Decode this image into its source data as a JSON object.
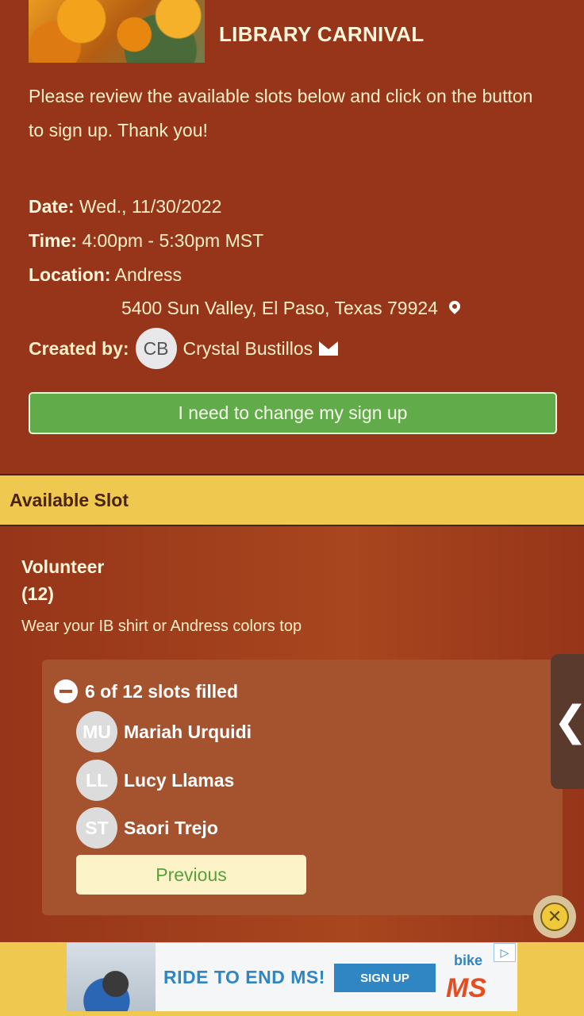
{
  "event": {
    "title": "LIBRARY CARNIVAL",
    "intro": "Please review the available slots below and click on the button to sign up. Thank you!"
  },
  "details": {
    "date_label": "Date:",
    "date_value": "Wed., 11/30/2022",
    "time_label": "Time:",
    "time_value": "4:00pm - 5:30pm MST",
    "location_label": "Location:",
    "location_value": "Andress",
    "address": "5400 Sun Valley, El Paso, Texas 79924",
    "created_label": "Created by:",
    "creator_initials": "CB",
    "creator_name": "Crystal Bustillos"
  },
  "change_button": "I need to change my sign up",
  "slot_section": {
    "header": "Available Slot",
    "title": "Volunteer",
    "count": "(12)",
    "note": "Wear your IB shirt or Andress colors top",
    "filled_text": "6 of 12 slots filled",
    "people": [
      {
        "initials": "MU",
        "name": "Mariah Urquidi"
      },
      {
        "initials": "LL",
        "name": "Lucy Llamas"
      },
      {
        "initials": "ST",
        "name": "Saori Trejo"
      }
    ],
    "previous_button": "Previous"
  },
  "side_tab_glyph": "❮",
  "ad": {
    "headline": "RIDE TO END MS!",
    "cta": "SIGN UP",
    "brand_top": "bike",
    "brand_bottom": "MS",
    "close_glyph": "✕",
    "play_glyph": "▷"
  },
  "colors": {
    "background": "#963519",
    "accent_yellow": "#efc94f",
    "button_green": "#62ab4a"
  }
}
